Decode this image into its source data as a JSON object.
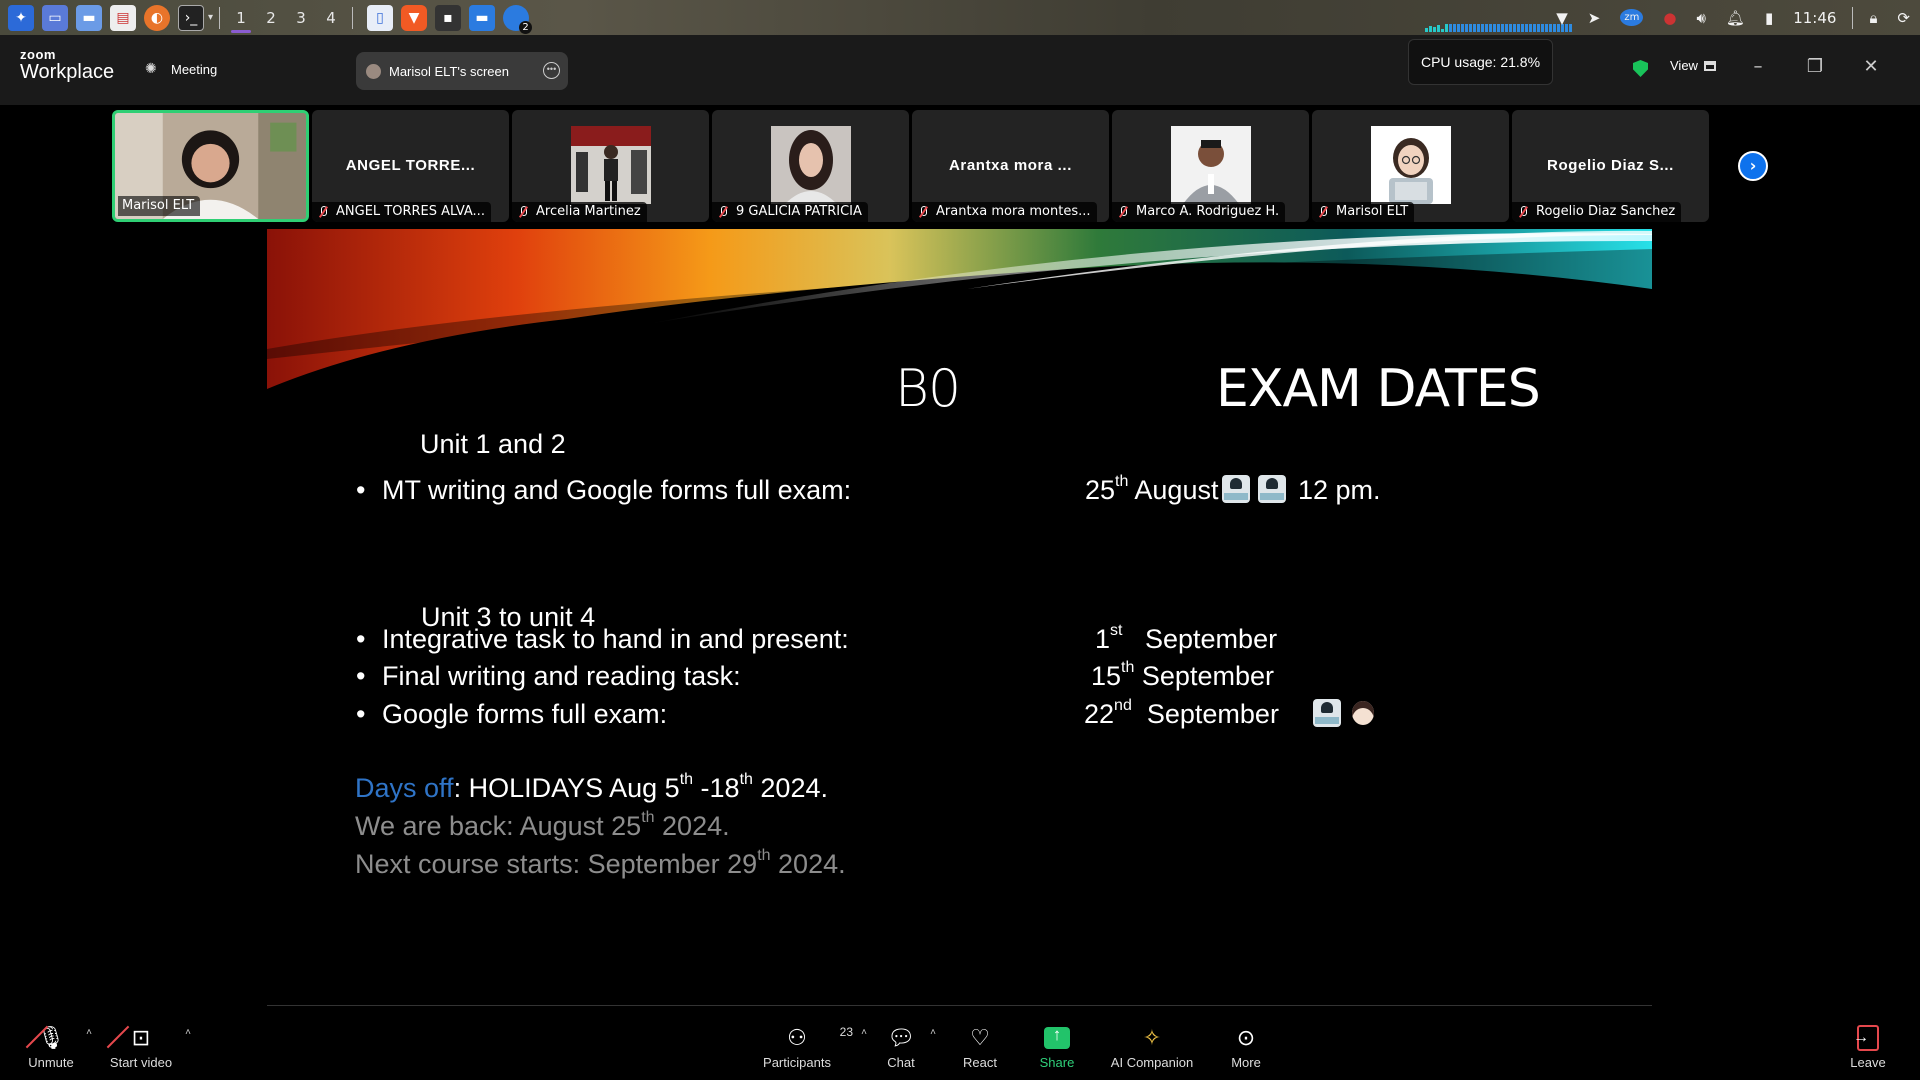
{
  "taskbar": {
    "workspaces": [
      "1",
      "2",
      "3",
      "4"
    ],
    "clock": "11:46",
    "badge_count": "2"
  },
  "header": {
    "brand_top": "zoom",
    "brand_bottom": "Workplace",
    "meeting_label": "Meeting",
    "share_pill": "Marisol ELT's screen",
    "cpu_usage": "CPU usage: 21.8%",
    "view_label": "View"
  },
  "participants_strip": [
    {
      "caption": "Marisol ELT",
      "display": "video",
      "active": true
    },
    {
      "caption": "ANGEL TORRES ALVA...",
      "display": "name",
      "name": "ANGEL TORRE..."
    },
    {
      "caption": "Arcelia Martinez",
      "display": "photo"
    },
    {
      "caption": "9 GALICIA PATRICIA",
      "display": "photo"
    },
    {
      "caption": "Arantxa mora montes...",
      "display": "name",
      "name": "Arantxa mora ..."
    },
    {
      "caption": "Marco A. Rodriguez H.",
      "display": "photo"
    },
    {
      "caption": "Marisol ELT",
      "display": "photo"
    },
    {
      "caption": "Rogelio Diaz Sanchez",
      "display": "name",
      "name": "Rogelio Diaz S..."
    }
  ],
  "slide": {
    "title_left": "B0",
    "title_right": "EXAM DATES",
    "section1": "Unit 1 and 2",
    "item1_label": "MT writing and Google forms full exam:",
    "item1_day": "25",
    "item1_sup": "th",
    "item1_month": "August",
    "item1_time": "12 pm.",
    "section2": "Unit 3 to unit 4",
    "item2_label": "Integrative task to hand in and present:",
    "item2_day": "1",
    "item2_sup": "st",
    "item2_month": "September",
    "item3_label": "Final writing and reading task:",
    "item3_day": "15",
    "item3_sup": "th",
    "item3_month": "September",
    "item4_label": "Google forms full exam:",
    "item4_day": "22",
    "item4_sup": "nd",
    "item4_month": "September",
    "days_off_label": "Days off",
    "days_off_a": ": HOLIDAYS Aug 5",
    "days_off_sup1": "th",
    "days_off_b": " -18",
    "days_off_sup2": "th",
    "days_off_c": " 2024.",
    "back_a": "We are back: August 25",
    "back_sup": "th",
    "back_b": " 2024.",
    "next_a": "Next course starts: September 29",
    "next_sup": "th",
    "next_b": " 2024."
  },
  "toolbar": {
    "unmute": "Unmute",
    "start_video": "Start video",
    "participants": "Participants",
    "participants_count": "23",
    "chat": "Chat",
    "react": "React",
    "share": "Share",
    "ai_companion": "AI Companion",
    "more": "More",
    "leave": "Leave"
  },
  "colors": {
    "accent_green": "#2fcf74",
    "share_green": "#22c36a",
    "blue_link": "#2f74c7",
    "muted_red": "#e5484d",
    "zoom_blue": "#0e72ed"
  }
}
